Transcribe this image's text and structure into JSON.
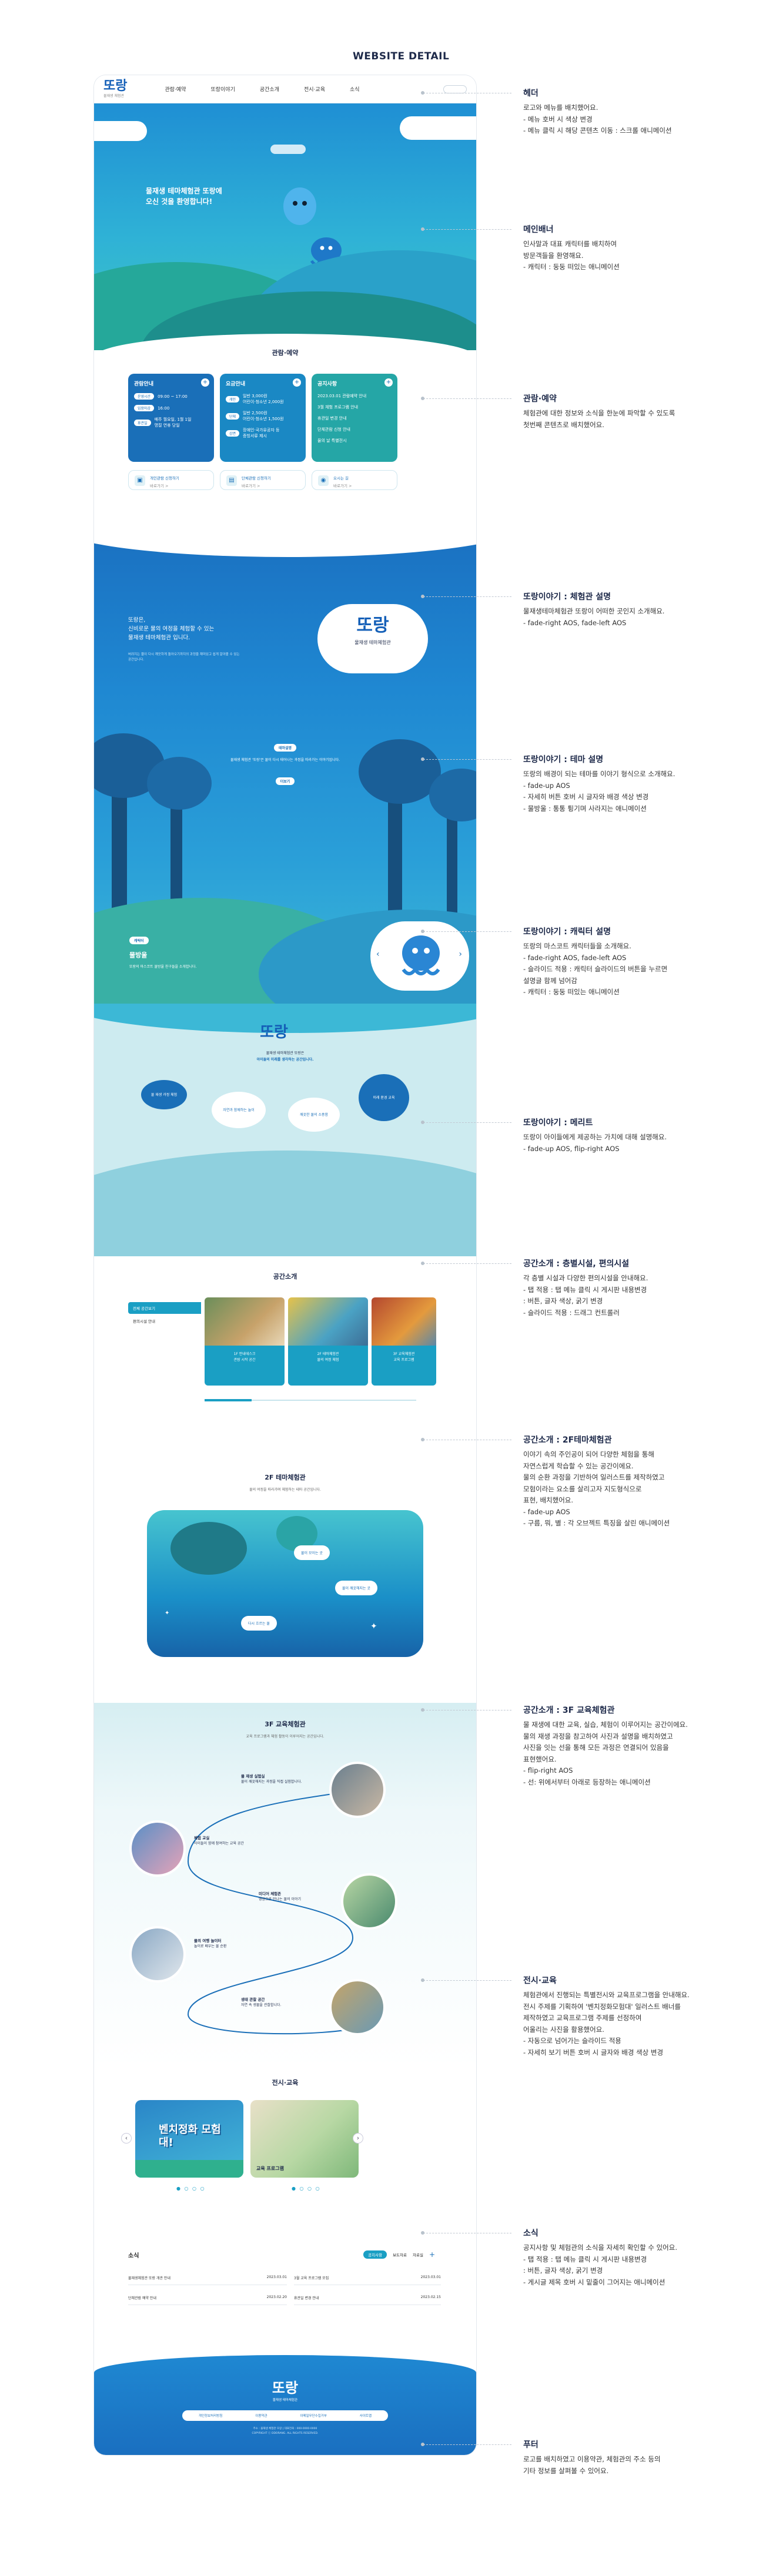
{
  "page_title": "WEBSITE DETAIL",
  "site": {
    "logo": "또랑",
    "logo_sub": "물재생 체험관",
    "nav": [
      "관람·예약",
      "또랑이야기",
      "공간소개",
      "전시·교육",
      "소식"
    ]
  },
  "banner": {
    "text": "물재생 테마체험관 또랑에\n오신 것을 환영합니다!"
  },
  "reserve": {
    "title": "관람·예약",
    "cards": [
      {
        "title": "관람안내",
        "rows": [
          [
            "운영시간",
            "09:00 ~ 17:00"
          ],
          [
            "입장마감",
            "16:00"
          ],
          [
            "휴관일",
            "매주 월요일, 1월 1일\n명절 연휴 당일"
          ]
        ]
      },
      {
        "title": "요금안내",
        "rows": [
          [
            "개인",
            "일반 3,000원\n어린이·청소년 2,000원"
          ],
          [
            "단체",
            "일반 2,500원\n어린이·청소년 1,500원"
          ],
          [
            "감면",
            "장애인·국가유공자 등\n증빙서류 제시"
          ]
        ]
      },
      {
        "title": "공지사항",
        "rows": [
          [
            "공지",
            "2023.03.01 관람예약 안내"
          ],
          [
            "공지",
            "3월 체험 프로그램 안내"
          ],
          [
            "공지",
            "휴관일 변경 안내"
          ],
          [
            "공지",
            "단체관람 신청 안내"
          ],
          [
            "공지",
            "물의 날 특별전시"
          ]
        ]
      }
    ],
    "quick": [
      {
        "icon": "▣",
        "label": "개인관람 신청하기",
        "sub": "바로가기 >"
      },
      {
        "icon": "▤",
        "label": "단체관람 신청하기",
        "sub": "바로가기 >"
      },
      {
        "icon": "◉",
        "label": "오시는 길",
        "sub": "바로가기 >"
      }
    ]
  },
  "story": {
    "intro": "또랑은,\n신비로운 물의 여정을 체험할 수 있는\n물재생 테마체험관 입니다.",
    "intro_sub": "버려지는 물이 다시 깨끗하게 돌아오기까지의 과정을 재미있고 쉽게 알아볼 수 있는 공간입니다.",
    "bubble_title": "또랑",
    "bubble_sub": "물재생 테마체험관",
    "theme_tag": "테마설명",
    "theme_text": "물재생 체험관 '또랑'은 물이 다시 태어나는 과정을 따라가는 이야기입니다.",
    "theme_btn": "더보기",
    "char_label": "캐릭터",
    "char_name": "물방울",
    "char_desc": "또랑의 마스코트 물방울 친구들을 소개합니다."
  },
  "merit": {
    "logo": "또랑",
    "line1": "물재생 테마체험관 또랑은",
    "line2": "아이들의 미래를 생각하는 공간입니다.",
    "discs": [
      "물 재생 과정 체험",
      "자연과 함께하는 놀이",
      "깨끗한 물의 소중함",
      "미래 환경 교육"
    ]
  },
  "space": {
    "title": "공간소개",
    "tabs": [
      "전체 공간보기",
      "편의시설 안내"
    ],
    "thumbs": [
      {
        "cap": "1F 안내데스크\n관람 시작 공간"
      },
      {
        "cap": "2F 테마체험관\n물의 여정 체험"
      },
      {
        "cap": "3F 교육체험관\n교육 프로그램"
      }
    ]
  },
  "f2": {
    "title": "2F 테마체험관",
    "sub": "물의 여정을 따라가며 체험하는 테마 공간입니다.",
    "labels": [
      "물이 모이는 곳",
      "물이 깨끗해지는 곳",
      "다시 흐르는 물"
    ]
  },
  "f3": {
    "title": "3F 교육체험관",
    "sub": "교육 프로그램과 체험 활동이 이루어지는 공간입니다.",
    "items": [
      {
        "t": "물 재생 실험실",
        "d": "물이 깨끗해지는 과정을 직접 실험합니다."
      },
      {
        "t": "체험 교실",
        "d": "아이들이 함께 참여하는 교육 공간"
      },
      {
        "t": "미디어 체험존",
        "d": "영상으로 만나는 물의 이야기"
      },
      {
        "t": "물의 여행 놀이터",
        "d": "놀이로 배우는 물 순환"
      },
      {
        "t": "생태 관찰 공간",
        "d": "자연 속 생물을 관찰합니다."
      }
    ]
  },
  "exhibit": {
    "title": "전시·교육",
    "cards": [
      "벤치정화 모험대!",
      "교육 프로그램"
    ]
  },
  "news": {
    "title": "소식",
    "tabs": [
      "공지사항",
      "보도자료",
      "자료실"
    ],
    "rows": [
      [
        "물재생체험관 또랑 개관 안내",
        "2023.03.01"
      ],
      [
        "3월 교육 프로그램 모집",
        "2023.03.01"
      ],
      [
        "단체관람 예약 안내",
        "2023.02.20"
      ],
      [
        "휴관일 변경 안내",
        "2023.02.15"
      ]
    ]
  },
  "footer": {
    "logo": "또랑",
    "sub": "물재생 테마체험관",
    "links": [
      "개인정보처리방침",
      "이용약관",
      "이메일무단수집거부",
      "사이트맵"
    ],
    "info": "주소 : 물재생 체험관 또랑 | 대표전화 : 000-0000-0000\nCOPYRIGHT ⓒ DDORANG. ALL RIGHTS RESERVED."
  },
  "annotations": [
    {
      "h": "헤더",
      "t": "로고와 메뉴를 배치했어요.\n- 메뉴 호버 시 색상 변경\n- 메뉴 클릭 시 해당 콘텐츠 이동 : 스크롤 애니메이션"
    },
    {
      "h": "메인배너",
      "t": "인사말과 대표 캐릭터를 배치하여\n방문객들을 환영해요.\n- 캐릭터 : 둥둥 떠있는 애니메이션"
    },
    {
      "h": "관람·예약",
      "t": "체험관에 대한 정보와 소식을 한눈에 파악할 수 있도록\n첫번째 콘텐츠로 배치했어요."
    },
    {
      "h": "또랑이야기 : 체험관 설명",
      "t": "물재생테마체험관 또랑이 어떠한 곳인지 소개해요.\n- fade-right AOS, fade-left AOS"
    },
    {
      "h": "또랑이야기 : 테마 설명",
      "t": "또랑의 배경이 되는 테마를 이야기 형식으로 소개해요.\n- fade-up AOS\n- 자세히 버튼 호버 시 글자와 배경 색상 변경\n- 물방울 : 통통 튕기며 사라지는 애니메이션"
    },
    {
      "h": "또랑이야기 : 캐릭터 설명",
      "t": "또랑의 마스코트 캐릭터들을 소개해요.\n- fade-right AOS, fade-left AOS\n- 슬라이드 적용 : 캐릭터 슬라이드의 버튼을 누르면\n  설명글 함께 넘어감\n- 캐릭터 : 둥둥 떠있는 애니메이션"
    },
    {
      "h": "또랑이야기 : 메리트",
      "t": "또랑이 아이들에게 제공하는 가치에 대해 설명해요.\n- fade-up AOS, flip-right AOS"
    },
    {
      "h": "공간소개 : 층별시설, 편의시설",
      "t": "각 층별 시설과 다양한 편의시설을 안내해요.\n- 탭 적용 : 탭 메뉴 클릭 시 게시판 내용변경\n  : 버튼, 글자 색상, 굵기 변경\n- 슬라이드 적용 : 드래그 컨트롤러"
    },
    {
      "h": "공간소개 : 2F테마체험관",
      "t": "이야기 속의 주인공이 되어 다양한 체험을 통해\n자연스럽게 학습할 수 있는 공간이에요.\n물의 순환 과정을 기반하여 일러스트를 제작하였고\n모험이라는 요소를 살리고자 지도형식으로\n표현, 배치했어요.\n- fade-up AOS\n- 구름, 뭐, 별 : 각 오브젝트 특징을 살린 애니메이션"
    },
    {
      "h": "공간소개 : 3F 교육체험관",
      "t": "물 재생에 대한 교육, 실습, 체험이 이루어지는 공간이에요.\n물의 재생 과정을 참고하여 사진과 설명을 배치하였고\n사진을 잇는 선을 통해 모든 과정은 연결되어 있음을\n표현했어요.\n- flip-right AOS\n- 선: 위에서부터 아래로 등장하는 애니메이션"
    },
    {
      "h": "전시·교육",
      "t": "체험관에서 진행되는 특별전시와 교육프로그램을 안내해요.\n전시 주제를 기획하여 '벤치정화모험대' 일러스트 배너를\n제작하였고 교육프로그램 주제를 선정하여\n어울리는 사진을 활용했어요.\n- 자동으로 넘어가는 슬라이드 적용\n- 자세히 보기 버튼 호버 시 글자와 배경 색상 변경"
    },
    {
      "h": "소식",
      "t": "공지사항 및 체험관의 소식을 자세히 확인할 수 있어요.\n- 탭 적용 : 탭 메뉴 클릭 시 게시판 내용변경\n  : 버튼, 글자 색상, 굵기 변경\n- 게시글 제목 호버 시 밑줄이 그어지는 애니메이션"
    },
    {
      "h": "푸터",
      "t": "로고를 배치하였고 이용약관, 체험관의 주소 등의\n기타 정보를 살펴볼 수 있어요."
    }
  ]
}
